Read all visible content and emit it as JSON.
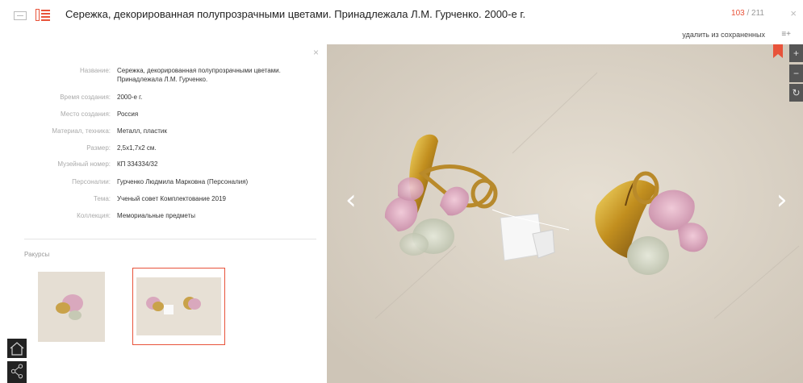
{
  "header": {
    "title": "Сережка, декорированная полупрозрачными цветами. Принадлежала Л.М. Гурченко. 2000-е г.",
    "counter_current": "103",
    "counter_separator": " / ",
    "counter_total": "211",
    "close_glyph": "×",
    "remove_saved_label": "удалить из сохраненных",
    "saved_icon_glyph": "≡+"
  },
  "info_panel": {
    "close_glyph": "×",
    "fields": [
      {
        "label": "Название:",
        "value": "Сережка, декорированная полупрозрачными цветами. Принадлежала Л.М. Гурченко."
      },
      {
        "label": "Время создания:",
        "value": "2000-е г."
      },
      {
        "label": "Место создания:",
        "value": "Россия"
      },
      {
        "label": "Материал, техника:",
        "value": "Металл, пластик"
      },
      {
        "label": "Размер:",
        "value": "2,5х1,7х2 см."
      },
      {
        "label": "Музейный номер:",
        "value": "КП 334334/32"
      },
      {
        "label": "Персоналии:",
        "value": "Гурченко Людмила Марковна (Персоналия)"
      },
      {
        "label": "Тема:",
        "value": "Ученый совет Комплектование 2019"
      },
      {
        "label": "Коллекция:",
        "value": "Мемориальные предметы"
      }
    ],
    "views_label": "Ракурсы"
  },
  "viewer": {
    "zoom_in_glyph": "+",
    "zoom_out_glyph": "−",
    "reset_glyph": "↻",
    "prev_glyph": "‹",
    "next_glyph": "›"
  },
  "colors": {
    "accent": "#e8533a",
    "photo_background": "#ddd5c9"
  },
  "icons": [
    "grid-view-icon",
    "list-view-icon",
    "bookmark-icon",
    "home-icon",
    "share-icon"
  ]
}
